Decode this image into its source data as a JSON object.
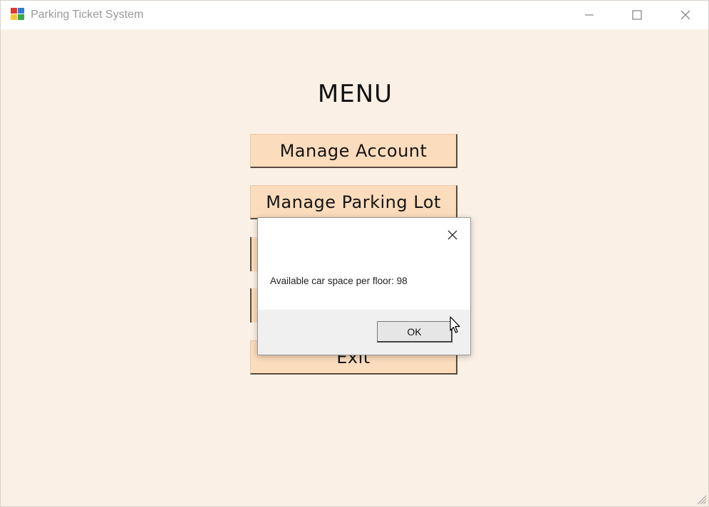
{
  "window": {
    "title": "Parking Ticket System",
    "controls": {
      "minimize": "minimize",
      "maximize": "maximize",
      "close": "close"
    }
  },
  "menu": {
    "title": "MENU",
    "buttons": {
      "manage_account": "Manage Account",
      "manage_parking_lot": "Manage Parking Lot",
      "exit": "Exit"
    }
  },
  "dialog": {
    "message": "Available car space per floor: 98",
    "ok_label": "OK"
  },
  "icons": {
    "app": "app-icon",
    "dialog_close": "close-icon",
    "cursor": "mouse-pointer-icon"
  },
  "colors": {
    "background": "#fbf0e5",
    "button": "#fbdcbc",
    "dialog_footer": "#f0f0f0"
  }
}
